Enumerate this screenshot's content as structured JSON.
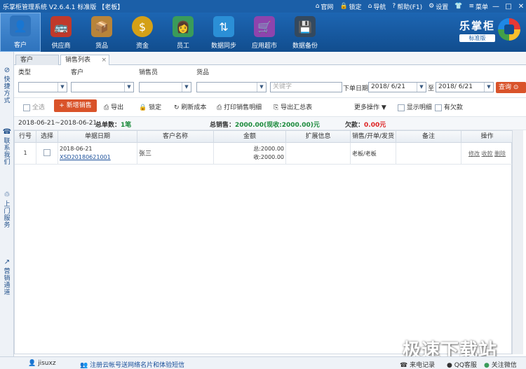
{
  "window": {
    "title": "乐掌柜管理系统 V2.6.4.1 标准版 【老板】",
    "links": [
      {
        "icon": "home-icon",
        "glyph": "⌂",
        "label": "官网"
      },
      {
        "icon": "lock-icon",
        "glyph": "🔒",
        "label": "锁定"
      },
      {
        "icon": "nav-icon",
        "glyph": "⌂",
        "label": "导航"
      },
      {
        "icon": "help-icon",
        "glyph": "?",
        "label": "帮助(F1)"
      },
      {
        "icon": "gear-icon",
        "glyph": "⚙",
        "label": "设置"
      },
      {
        "icon": "shirt-icon",
        "glyph": "👕",
        "label": ""
      },
      {
        "icon": "menu-icon",
        "glyph": "≡",
        "label": "菜单"
      }
    ],
    "controls": {
      "minimize": "—",
      "maximize": "□",
      "close": "✕"
    }
  },
  "toolbar": {
    "items": [
      {
        "label": "客户",
        "icon": "customer-icon",
        "glyph": "👤",
        "color": "#2e73bd"
      },
      {
        "label": "供应商",
        "icon": "supplier-icon",
        "glyph": "🚌",
        "color": "#c0392b"
      },
      {
        "label": "货品",
        "icon": "goods-icon",
        "glyph": "📦",
        "color": "#b8843a"
      },
      {
        "label": "资金",
        "icon": "money-icon",
        "glyph": "$",
        "color": "#d4a017"
      },
      {
        "label": "员工",
        "icon": "staff-icon",
        "glyph": "👩",
        "color": "#3a9b5a"
      },
      {
        "label": "数据同步",
        "icon": "sync-icon",
        "glyph": "⇅",
        "color": "#2b8fd6"
      },
      {
        "label": "应用超市",
        "icon": "app-market-icon",
        "glyph": "🛒",
        "color": "#8e44ad"
      },
      {
        "label": "数据备份",
        "icon": "backup-icon",
        "glyph": "💾",
        "color": "#34495e"
      }
    ],
    "brand_name": "乐掌柜",
    "brand_edition": "标准版"
  },
  "sidebar": {
    "items": [
      {
        "icon": "shortcut-icon",
        "glyph": "⊘",
        "label": "快捷方式"
      },
      {
        "icon": "phone-icon",
        "glyph": "☎",
        "label": "联系我们"
      },
      {
        "icon": "bike-icon",
        "glyph": "♲",
        "label": "上门服务"
      },
      {
        "icon": "chart-icon",
        "glyph": "↗",
        "label": "营销通道"
      }
    ]
  },
  "tabs": [
    {
      "label": "客户"
    },
    {
      "label": "销售列表",
      "close": "×"
    }
  ],
  "filters": {
    "type_label": "类型",
    "customer_label": "客户",
    "salesperson_label": "销售员",
    "goods_label": "货品",
    "keyword_placeholder": "关键字",
    "date_label": "下单日期",
    "date_from": "2018/ 6/21",
    "to_label": "至",
    "date_to": "2018/ 6/21",
    "query_button": "查询",
    "dropdown_arrow": "▼"
  },
  "actions": {
    "select_all": "全选",
    "new_sale": "+ 新增销售",
    "export": "导出",
    "lock": "锁定",
    "refresh_cost": "刷新成本",
    "print_detail": "打印销售明细",
    "export_summary": "导出汇总表",
    "more_actions": "更多操作",
    "show_detail": "显示明细",
    "has_debt": "有欠款"
  },
  "summary": {
    "date_range": "2018-06-21~2018-06-21",
    "total_orders_label": "总单数：",
    "total_orders_value": "1笔",
    "total_sales_label": "总销售：",
    "total_sales_value": "2000.00(现收:2000.00)元",
    "debt_label": "欠款：",
    "debt_value": "0.00元"
  },
  "table": {
    "columns": [
      "行号",
      "选择",
      "单据日期",
      "客户名称",
      "金额",
      "扩展信息",
      "销售/开单/发货",
      "备注",
      "操作"
    ],
    "rows": [
      {
        "index": "1",
        "date": "2018-06-21",
        "doc_no": "XSD20180621001",
        "customer": "张三",
        "amount_total": "总:2000.00",
        "amount_received": "收:2000.00",
        "ext": "",
        "staff": "老板/老板",
        "remark": "",
        "edit": "修改",
        "collect": "收款",
        "delete": "删除"
      }
    ]
  },
  "statusbar": {
    "user": "jisuxz",
    "register_link": "注册云帐号送网络名片和体验短信",
    "call_log": "来电记录",
    "qq_service": "QQ客服",
    "wechat": "关注微信"
  },
  "watermark": "极速下载站"
}
